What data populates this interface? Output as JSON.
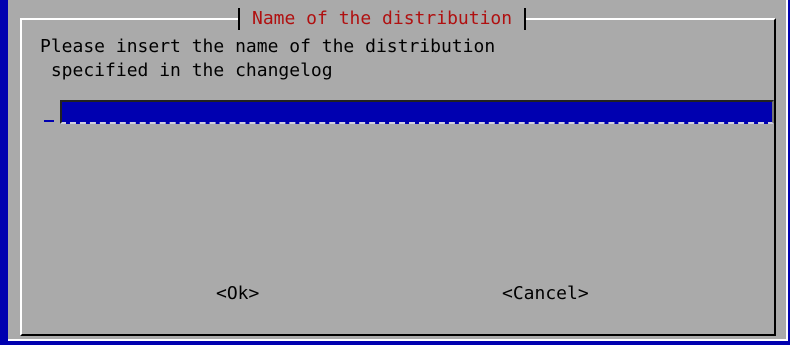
{
  "dialog": {
    "title": "Name of the distribution",
    "prompt_line1": "Please insert the name of the distribution",
    "prompt_line2": " specified in the changelog",
    "input_value": "",
    "ok_label": "<Ok>",
    "cancel_label": "<Cancel>"
  },
  "colors": {
    "background": "#0000b0",
    "dialog_bg": "#aaaaaa",
    "title_text": "#b01010",
    "input_bg": "#0000b0"
  }
}
